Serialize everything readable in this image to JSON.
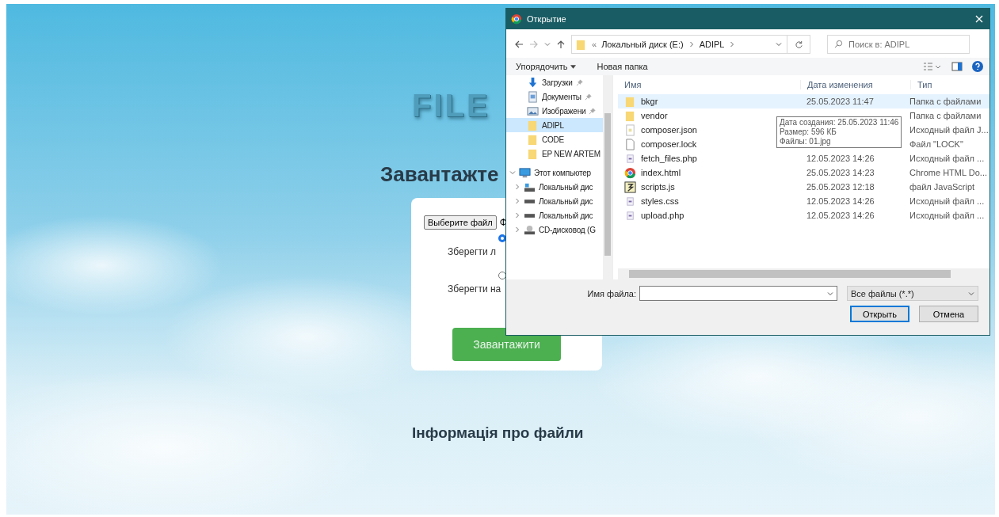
{
  "page": {
    "title": "FILE",
    "heading": "Завантажте",
    "upload_form": {
      "choose_button": "Выберите файл",
      "file_status": "Ф",
      "options": [
        {
          "label": "Зберегти л",
          "selected": true
        },
        {
          "label": "Зберегти на",
          "selected": false
        }
      ],
      "submit_button": "Завантажити"
    },
    "info_heading": "Інформація про файли"
  },
  "dialog": {
    "title": "Открытие",
    "path_prefix": "«",
    "path": [
      "Локальный диск (E:)",
      "ADIPL"
    ],
    "search": {
      "placeholder": "Поиск в: ADIPL"
    },
    "toolbar": {
      "organize": "Упорядочить",
      "new_folder": "Новая папка"
    },
    "nav_items": [
      {
        "kind": "downloads",
        "label": "Загрузки",
        "pinned": true,
        "selected": false
      },
      {
        "kind": "documents",
        "label": "Документы",
        "pinned": true,
        "selected": false
      },
      {
        "kind": "pictures",
        "label": "Изображени",
        "pinned": true,
        "selected": false
      },
      {
        "kind": "folder",
        "label": "ADIPL",
        "pinned": false,
        "selected": true
      },
      {
        "kind": "folder",
        "label": "CODE",
        "pinned": false,
        "selected": false
      },
      {
        "kind": "folder",
        "label": "EP NEW ARTEM",
        "pinned": false,
        "selected": false
      },
      {
        "kind": "computer",
        "label": "Этот компьютер",
        "expanded": true,
        "selected": false,
        "children": [
          {
            "kind": "system-drive",
            "label": "Локальный дис",
            "expanded": false,
            "selected": false
          },
          {
            "kind": "drive",
            "label": "Локальный дис",
            "expanded": false,
            "selected": false
          },
          {
            "kind": "drive",
            "label": "Локальный дис",
            "expanded": false,
            "selected": false
          },
          {
            "kind": "cd",
            "label": "CD-дисковод (G",
            "expanded": false,
            "selected": false
          }
        ]
      }
    ],
    "columns": [
      "Имя",
      "Дата изменения",
      "Тип"
    ],
    "files": [
      {
        "kind": "folder",
        "name": "bkgr",
        "date": "25.05.2023 11:47",
        "type": "Папка с файлами",
        "selected": true
      },
      {
        "kind": "folder",
        "name": "vendor",
        "type": "Папка с файлами",
        "selected": false
      },
      {
        "kind": "json",
        "name": "composer.json",
        "type": "Исходный файл J...",
        "selected": false
      },
      {
        "kind": "file",
        "name": "composer.lock",
        "type": "Файл \"LOCK\"",
        "selected": false
      },
      {
        "kind": "php",
        "name": "fetch_files.php",
        "date": "12.05.2023 14:26",
        "type": "Исходный файл ...",
        "selected": false
      },
      {
        "kind": "chrome",
        "name": "index.html",
        "date": "25.05.2023 14:23",
        "type": "Chrome HTML Do...",
        "selected": false
      },
      {
        "kind": "js",
        "name": "scripts.js",
        "date": "25.05.2023 12:18",
        "type": "файл JavaScript",
        "selected": false
      },
      {
        "kind": "css",
        "name": "styles.css",
        "date": "12.05.2023 14:26",
        "type": "Исходный файл ...",
        "selected": false
      },
      {
        "kind": "php",
        "name": "upload.php",
        "date": "12.05.2023 14:26",
        "type": "Исходный файл ...",
        "selected": false
      }
    ],
    "tooltip": [
      "Дата создания: 25.05.2023 11:46",
      "Размер: 596 КБ",
      "Файлы: 01.jpg"
    ],
    "filename_label": "Имя файла:",
    "filter": "Все файлы (*.*)",
    "buttons": [
      {
        "label": "Открыть",
        "default": true
      },
      {
        "label": "Отмена",
        "default": false
      }
    ]
  }
}
